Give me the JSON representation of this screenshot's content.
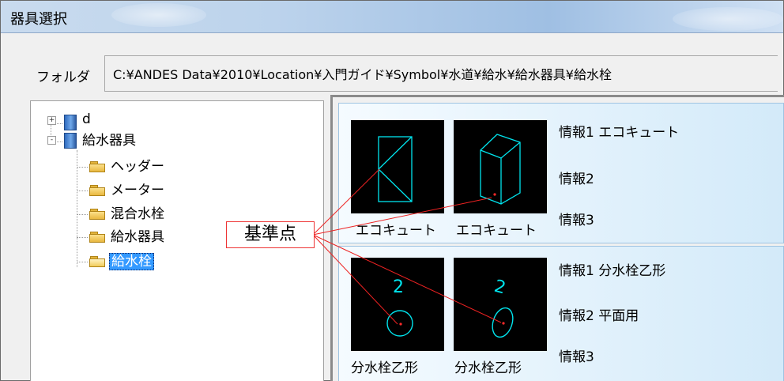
{
  "window": {
    "title": "器具選択"
  },
  "folder": {
    "label": "フォルダ",
    "path": "C:¥ANDES Data¥2010¥Location¥入門ガイド¥Symbol¥水道¥給水¥給水器具¥給水栓"
  },
  "tree": {
    "nodes": [
      {
        "label": "d",
        "icon": "book-icon",
        "expander": "+"
      },
      {
        "label": "給水器具",
        "icon": "book-icon",
        "expander": "-"
      },
      {
        "label": "ヘッダー",
        "icon": "folder-icon"
      },
      {
        "label": "メーター",
        "icon": "folder-icon"
      },
      {
        "label": "混合水栓",
        "icon": "folder-icon"
      },
      {
        "label": "給水器具",
        "icon": "folder-icon"
      },
      {
        "label": "給水栓",
        "icon": "folder-open-icon",
        "selected": true
      }
    ]
  },
  "symbols": [
    {
      "thumbs": [
        {
          "caption": "エコキュート"
        },
        {
          "caption": "エコキュート"
        }
      ],
      "info": [
        "情報1 エコキュート",
        "情報2",
        "情報3"
      ]
    },
    {
      "thumbs": [
        {
          "caption": "分水栓乙形"
        },
        {
          "caption": "分水栓乙形"
        }
      ],
      "info": [
        "情報1 分水栓乙形",
        "情報2 平面用",
        "情報3"
      ]
    }
  ],
  "callout": {
    "label": "基準点"
  },
  "colors": {
    "symbol_line": "#00e5ee",
    "base_point": "#ff2a2a",
    "callout_line": "#ee2222",
    "selection": "#3399ff"
  }
}
